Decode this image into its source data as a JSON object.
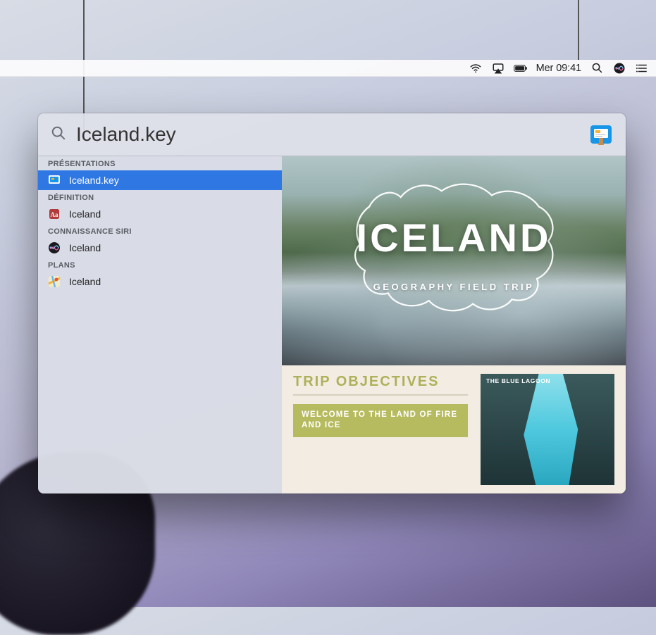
{
  "menubar": {
    "datetime": "Mer 09:41",
    "icons": [
      "wifi",
      "airplay",
      "battery",
      "spotlight",
      "siri",
      "notification-center"
    ]
  },
  "spotlight": {
    "search_value": "Iceland.key",
    "tophit_app": "Keynote",
    "sections": [
      {
        "header": "PRÉSENTATIONS",
        "items": [
          {
            "icon": "keynote-doc",
            "label": "Iceland.key",
            "selected": true
          }
        ]
      },
      {
        "header": "DÉFINITION",
        "items": [
          {
            "icon": "dictionary",
            "label": "Iceland",
            "selected": false
          }
        ]
      },
      {
        "header": "CONNAISSANCE SIRI",
        "items": [
          {
            "icon": "siri",
            "label": "Iceland",
            "selected": false
          }
        ]
      },
      {
        "header": "PLANS",
        "items": [
          {
            "icon": "maps",
            "label": "Iceland",
            "selected": false
          }
        ]
      }
    ]
  },
  "preview": {
    "slide1": {
      "title": "ICELAND",
      "subtitle": "GEOGRAPHY FIELD TRIP"
    },
    "slide2": {
      "objectives_title": "TRIP OBJECTIVES",
      "welcome": "WELCOME TO THE LAND OF FIRE AND ICE",
      "lagoon_label": "THE BLUE LAGOON"
    }
  }
}
